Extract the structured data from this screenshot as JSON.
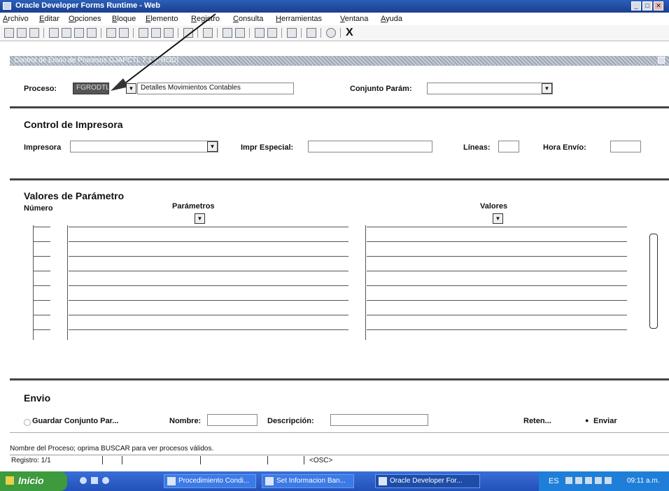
{
  "window": {
    "title": "Oracle Developer Forms Runtime - Web"
  },
  "menu": [
    "Archivo",
    "Editar",
    "Opciones",
    "Bloque",
    "Elemento",
    "Registro",
    "Consulta",
    "Herramientas",
    "Ventana",
    "Ayuda"
  ],
  "toolbar": {
    "exit_label": "X"
  },
  "form": {
    "title": "Control de Envío de Procesos  GJAPCTL  7.1  (PROD)"
  },
  "proceso": {
    "label": "Proceso:",
    "code": "FGRODTL",
    "description": "Detalles Movimientos Contables",
    "conjunto_label": "Conjunto Parám:",
    "conjunto_value": ""
  },
  "printer": {
    "heading": "Control de Impresora",
    "impresora_label": "Impresora",
    "impresora_value": "",
    "especial_label": "Impr Especial:",
    "lineas_label": "Líneas:",
    "hora_label": "Hora Envío:"
  },
  "params": {
    "heading": "Valores de Parámetro",
    "numero_label": "Número",
    "parametros_label": "Parámetros",
    "valores_label": "Valores"
  },
  "envio": {
    "heading": "Envio",
    "guardar_label": "Guardar Conjunto Par...",
    "nombre_label": "Nombre:",
    "descripcion_label": "Descripción:",
    "reten_label": "Reten...",
    "enviar_label": "Enviar"
  },
  "status": {
    "message": "Nombre del Proceso; oprima BUSCAR para ver procesos válidos.",
    "record": "Registro: 1/1",
    "osc": "<OSC>"
  },
  "taskbar": {
    "start": "Inicio",
    "tasks": [
      "Procedimiento Condi...",
      "Set Informacion Ban...",
      "Oracle Developer For..."
    ],
    "lang": "ES",
    "clock": "09:11 a.m."
  }
}
